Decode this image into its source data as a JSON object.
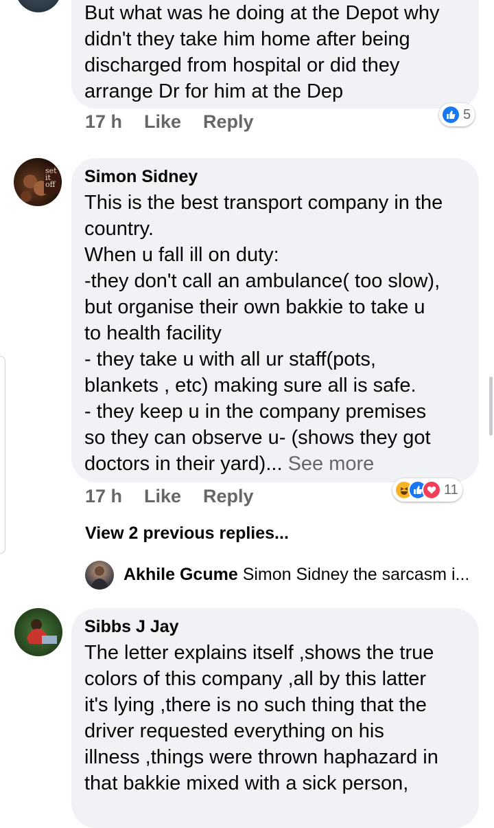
{
  "comments": [
    {
      "author": "",
      "text": "But what was he doing at the Depot why\ndidn't they take him home after being\ndischarged from hospital or did they\narrange Dr for him at the Dep",
      "time": "17 h",
      "like_label": "Like",
      "reply_label": "Reply",
      "reaction_icons": [
        "like-icon"
      ],
      "reaction_count": "5"
    },
    {
      "author": "Simon Sidney",
      "avatar_text": "set it off",
      "text": "This is the best transport company in the\ncountry.\nWhen u fall ill  on duty:\n-they don't call an ambulance( too slow),\nbut organise their own bakkie to take u\nto health facility\n- they take u with all ur staff(pots,\nblankets , etc) making sure all is safe.\n- they keep u in the company premises\nso they can observe u- (shows they got\ndoctors in their yard)...",
      "see_more": "See more",
      "time": "17 h",
      "like_label": "Like",
      "reply_label": "Reply",
      "reaction_icons": [
        "haha-icon",
        "like-icon",
        "love-icon"
      ],
      "reaction_count": "11"
    },
    {
      "author": "Sibbs J Jay",
      "text": "The letter explains itself ,shows the true\ncolors of this company ,all by this latter\nit's lying ,there is no such thing that the\ndriver requested everything on his\nillness ,things were thrown haphazard in\nthat bakkie mixed with a sick person,"
    }
  ],
  "view_previous": "View 2 previous replies...",
  "reply_preview": {
    "author": "Akhile Gcume",
    "text": "Simon Sidney the sarcasm i..."
  },
  "colors": {
    "bubble": "#f0f2f5",
    "meta": "#65676b",
    "like": "#1877f2",
    "love": "#f33e58",
    "haha": "#f7b125"
  }
}
